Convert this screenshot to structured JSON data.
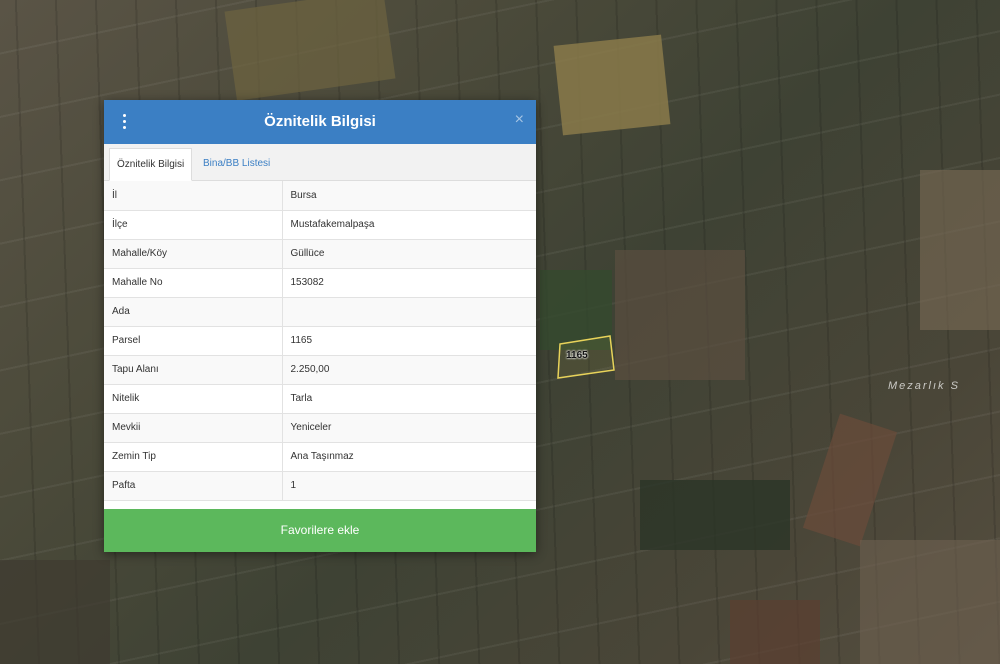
{
  "map": {
    "parcel_label": "1165",
    "place_label": "Mezarlık S"
  },
  "modal": {
    "title": "Öznitelik Bilgisi",
    "close_label": "×",
    "tabs": [
      {
        "label": "Öznitelik Bilgisi",
        "active": true
      },
      {
        "label": "Bina/BB Listesi",
        "active": false
      }
    ],
    "rows": [
      {
        "key": "İl",
        "value": "Bursa"
      },
      {
        "key": "İlçe",
        "value": "Mustafakemalpaşa"
      },
      {
        "key": "Mahalle/Köy",
        "value": "Güllüce"
      },
      {
        "key": "Mahalle No",
        "value": "153082"
      },
      {
        "key": "Ada",
        "value": ""
      },
      {
        "key": "Parsel",
        "value": "1165"
      },
      {
        "key": "Tapu Alanı",
        "value": "2.250,00"
      },
      {
        "key": "Nitelik",
        "value": "Tarla"
      },
      {
        "key": "Mevkii",
        "value": "Yeniceler"
      },
      {
        "key": "Zemin Tip",
        "value": "Ana Taşınmaz"
      },
      {
        "key": "Pafta",
        "value": "1"
      }
    ],
    "favorite_button": "Favorilere ekle"
  },
  "colors": {
    "header": "#3b7fc4",
    "button": "#5cb85c",
    "parcel_outline": "#e8d35a"
  }
}
